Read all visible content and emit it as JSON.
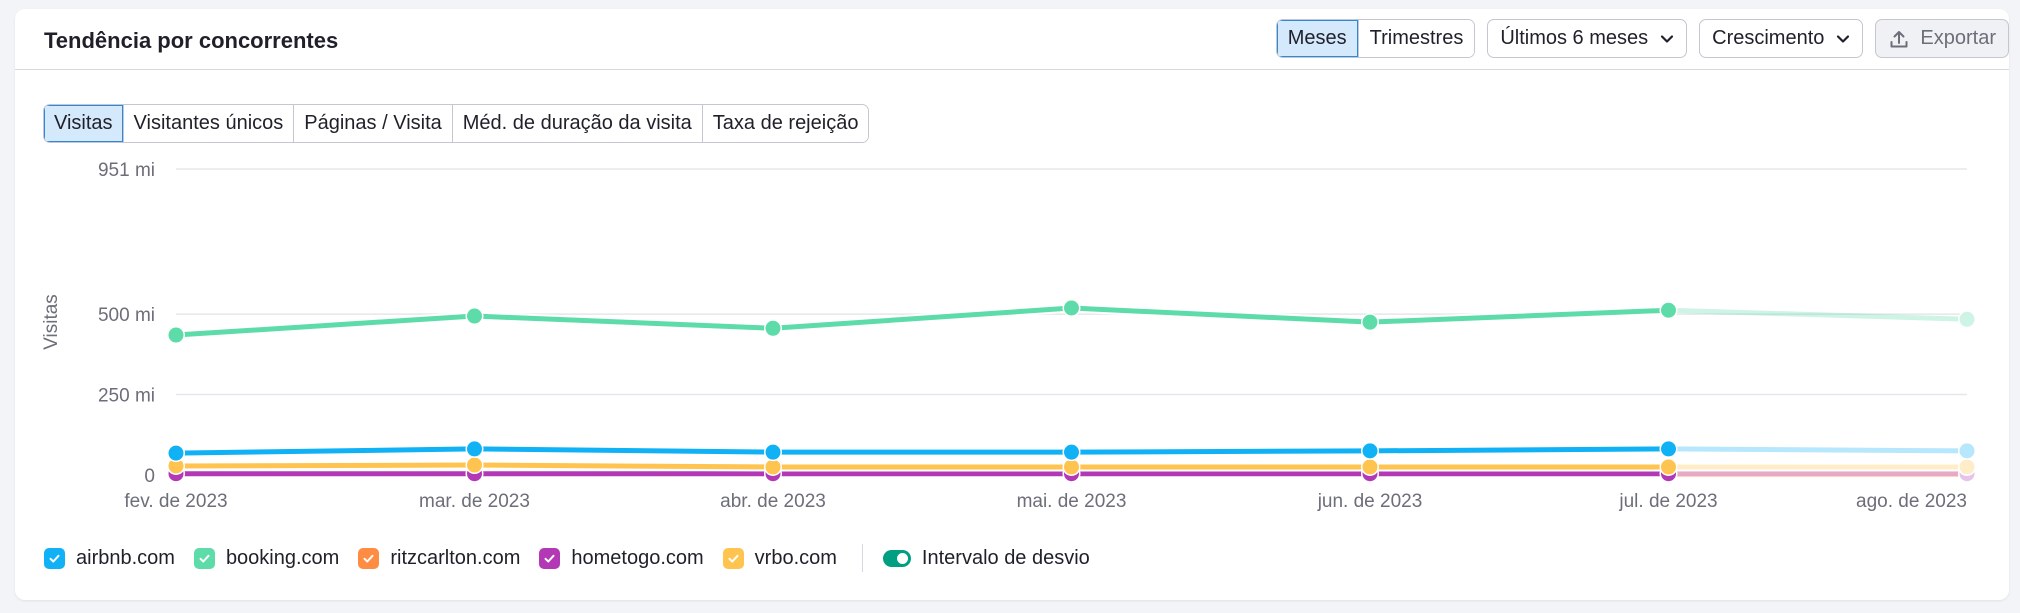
{
  "header": {
    "title": "Tendência por concorrentes",
    "period_toggle": [
      {
        "label": "Meses",
        "active": true
      },
      {
        "label": "Trimestres",
        "active": false
      }
    ],
    "range_dropdown": "Últimos 6 meses",
    "mode_dropdown": "Crescimento",
    "export_label": "Exportar"
  },
  "metric_tabs": [
    {
      "label": "Visitas",
      "active": true
    },
    {
      "label": "Visitantes únicos",
      "active": false
    },
    {
      "label": "Páginas / Visita",
      "active": false
    },
    {
      "label": "Méd. de duração da visita",
      "active": false
    },
    {
      "label": "Taxa de rejeição",
      "active": false
    }
  ],
  "legend": {
    "items": [
      {
        "label": "airbnb.com",
        "color": "#11b1f5",
        "checked": true
      },
      {
        "label": "booking.com",
        "color": "#5ddcaa",
        "checked": true
      },
      {
        "label": "ritzcarlton.com",
        "color": "#ff8c43",
        "checked": true
      },
      {
        "label": "hometogo.com",
        "color": "#b338b5",
        "checked": true
      },
      {
        "label": "vrbo.com",
        "color": "#ffc44f",
        "checked": true
      }
    ],
    "deviation_toggle": {
      "label": "Intervalo de desvio",
      "on": true,
      "color": "#009f81"
    }
  },
  "chart_data": {
    "type": "line",
    "title": "",
    "xlabel": "",
    "ylabel": "Visitas",
    "x": [
      "fev. de 2023",
      "mar. de 2023",
      "abr. de 2023",
      "mai. de 2023",
      "jun. de 2023",
      "jul. de 2023",
      "ago. de 2023"
    ],
    "yticks": [
      {
        "value": 0,
        "label": "0"
      },
      {
        "value": 250,
        "label": "250 mi"
      },
      {
        "value": 500,
        "label": "500 mi"
      },
      {
        "value": 951,
        "label": "951 mi"
      }
    ],
    "ylim": [
      0,
      951
    ],
    "y_units": "millions",
    "grid": true,
    "projected_last_point": true,
    "legend_position": "bottom-left",
    "series": [
      {
        "name": "booking.com",
        "color": "#5ddcaa",
        "values": [
          435,
          494,
          456,
          519,
          475,
          512,
          484
        ]
      },
      {
        "name": "airbnb.com",
        "color": "#11b1f5",
        "values": [
          68,
          81,
          71,
          71,
          75,
          81,
          75
        ]
      },
      {
        "name": "vrbo.com",
        "color": "#ffc44f",
        "values": [
          28,
          31,
          25,
          25,
          25,
          25,
          25
        ]
      },
      {
        "name": "ritzcarlton.com",
        "color": "#ff8c43",
        "values": [
          2,
          2,
          2,
          2,
          2,
          2,
          2
        ]
      },
      {
        "name": "hometogo.com",
        "color": "#b338b5",
        "values": [
          4,
          4,
          4,
          4,
          4,
          4,
          4
        ]
      }
    ]
  }
}
